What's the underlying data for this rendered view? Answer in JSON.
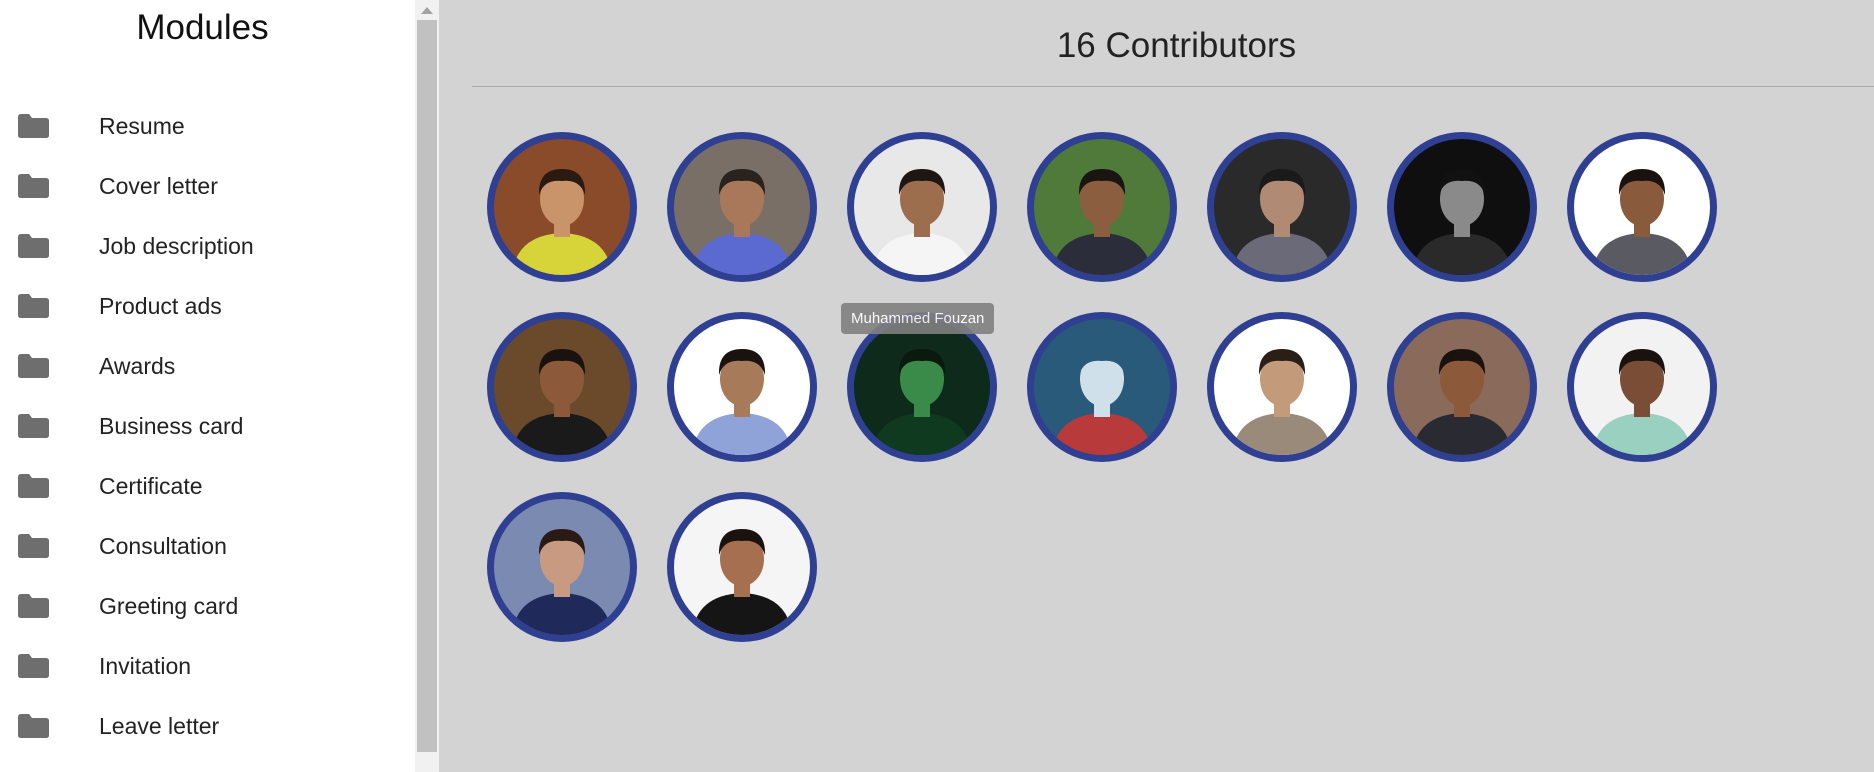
{
  "sidebar": {
    "title": "Modules",
    "items": [
      {
        "label": "Resume"
      },
      {
        "label": "Cover letter"
      },
      {
        "label": "Job description"
      },
      {
        "label": "Product ads"
      },
      {
        "label": "Awards"
      },
      {
        "label": "Business card"
      },
      {
        "label": "Certificate"
      },
      {
        "label": "Consultation"
      },
      {
        "label": "Greeting card"
      },
      {
        "label": "Invitation"
      },
      {
        "label": "Leave letter"
      }
    ],
    "icon": "folder-icon",
    "icon_color": "#6e6e6e"
  },
  "main": {
    "title": "16 Contributors",
    "tooltip": "Muhammed Fouzan",
    "avatar_ring_color": "#2f3f91",
    "avatars": [
      {
        "bg": "#8a4b2a",
        "face": "#c9946a",
        "shirt": "#d7d43a",
        "hair": "#2a1a12"
      },
      {
        "bg": "#7a6f66",
        "face": "#a9785a",
        "shirt": "#5a6ad0",
        "hair": "#2a221c"
      },
      {
        "bg": "#e8e8e8",
        "face": "#9c6e4e",
        "shirt": "#f5f5f5",
        "hair": "#1e1612"
      },
      {
        "bg": "#4f7a3a",
        "face": "#8c5e40",
        "shirt": "#2b2d3a",
        "hair": "#1b1512"
      },
      {
        "bg": "#2a2a2a",
        "face": "#b08a72",
        "shirt": "#6a6a78",
        "hair": "#1a1a1a"
      },
      {
        "bg": "#0f0f0f",
        "face": "#8a8a8a",
        "shirt": "#2a2a2a",
        "hair": "#111111"
      },
      {
        "bg": "#ffffff",
        "face": "#8a5a3c",
        "shirt": "#5a5a62",
        "hair": "#1a120e"
      },
      {
        "bg": "#6a4a2a",
        "face": "#8c5a3a",
        "shirt": "#1a1a1a",
        "hair": "#1a120e"
      },
      {
        "bg": "#ffffff",
        "face": "#a77a5a",
        "shirt": "#8fa3d8",
        "hair": "#1a120e"
      },
      {
        "bg": "#0e2a1a",
        "face": "#3a8a4a",
        "shirt": "#0f3a1f",
        "hair": "#0a1a0e"
      },
      {
        "bg": "#2a5a7a",
        "face": "#cfe0ea",
        "shirt": "#b83a3a",
        "hair": "#2a5a7a"
      },
      {
        "bg": "#ffffff",
        "face": "#c39a7a",
        "shirt": "#9a8a7a",
        "hair": "#2a1e16"
      },
      {
        "bg": "#8a6a5a",
        "face": "#8c5a3a",
        "shirt": "#2a2a32",
        "hair": "#1a120e"
      },
      {
        "bg": "#f2f2f2",
        "face": "#7a4e36",
        "shirt": "#9ad0c0",
        "hair": "#1a120e"
      },
      {
        "bg": "#7a8ab0",
        "face": "#c99a82",
        "shirt": "#1f2a5a",
        "hair": "#2a1a16"
      },
      {
        "bg": "#f5f5f5",
        "face": "#a67050",
        "shirt": "#151515",
        "hair": "#1a120e"
      }
    ]
  }
}
